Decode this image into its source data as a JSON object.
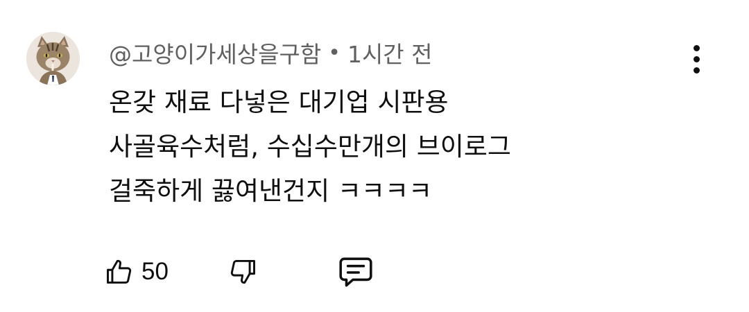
{
  "comment": {
    "author": "@고양이가세상을구함",
    "separator": "•",
    "time": "1시간 전",
    "lines": [
      "온갖 재료 다넣은 대기업 시판용",
      "사골육수처럼, 수십수만개의 브이로그",
      "걸죽하게 끓여낸건지 ㅋㅋㅋㅋ"
    ],
    "like_count": "50"
  },
  "icons": {
    "avatar": "cat-avatar",
    "menu": "more-vertical-icon",
    "like": "thumbs-up-icon",
    "dislike": "thumbs-down-icon",
    "reply": "reply-comment-icon"
  },
  "colors": {
    "text_primary": "#0f0f0f",
    "text_secondary": "#606060",
    "background": "#ffffff"
  }
}
